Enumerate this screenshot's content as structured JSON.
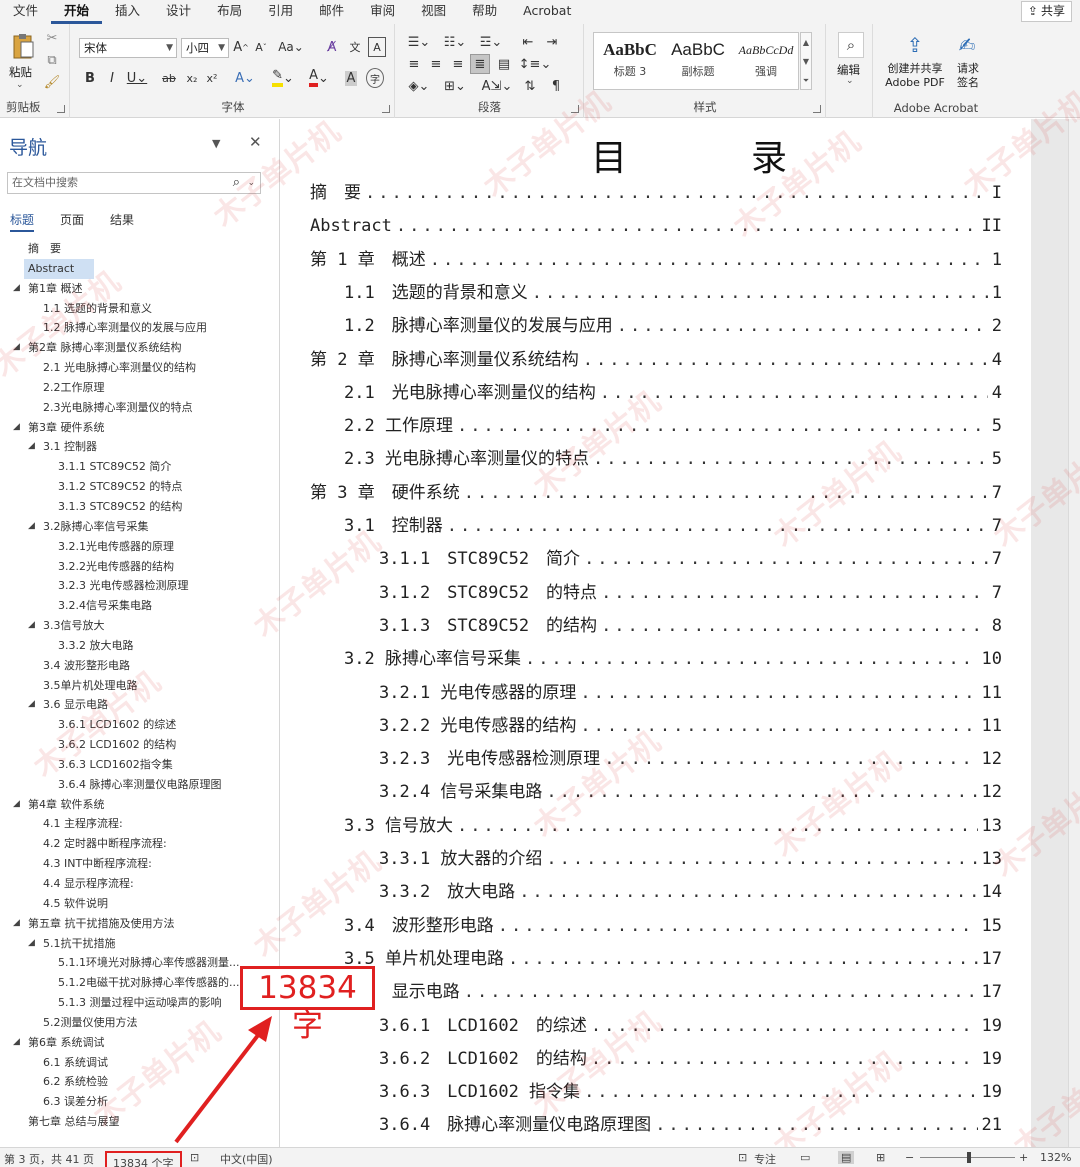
{
  "ribbon": {
    "tabs": [
      "文件",
      "开始",
      "插入",
      "设计",
      "布局",
      "引用",
      "邮件",
      "审阅",
      "视图",
      "帮助",
      "Acrobat"
    ],
    "active_tab": "开始",
    "share_label": "共享",
    "groups": {
      "clipboard": {
        "label": "剪贴板",
        "paste_label": "粘贴"
      },
      "font": {
        "label": "字体",
        "font_name": "宋体",
        "font_size": "小四"
      },
      "paragraph": {
        "label": "段落"
      },
      "styles": {
        "label": "样式",
        "items": [
          {
            "preview": "AaBbC",
            "name": "标题 3"
          },
          {
            "preview": "AaBbC",
            "name": "副标题"
          },
          {
            "preview": "AaBbCcDd",
            "name": "强调"
          }
        ]
      },
      "editing": {
        "label": "编辑"
      },
      "acrobat": {
        "label": "Adobe Acrobat",
        "create_share_line1": "创建并共享",
        "create_share_line2": "Adobe PDF",
        "request_sign_line1": "请求",
        "request_sign_line2": "签名"
      }
    }
  },
  "nav": {
    "title": "导航",
    "search_placeholder": "在文档中搜索",
    "tabs": [
      "标题",
      "页面",
      "结果"
    ],
    "active_tab": "标题",
    "items": [
      {
        "label": "摘　要",
        "level": 1,
        "arrow": false
      },
      {
        "label": "Abstract",
        "level": 1,
        "arrow": false,
        "selected": true
      },
      {
        "label": "第1章 概述",
        "level": 1,
        "arrow": true
      },
      {
        "label": "1.1 选题的背景和意义",
        "level": 2,
        "arrow": false
      },
      {
        "label": "1.2 脉搏心率测量仪的发展与应用",
        "level": 2,
        "arrow": false
      },
      {
        "label": "第2章 脉搏心率测量仪系统结构",
        "level": 1,
        "arrow": true
      },
      {
        "label": "2.1 光电脉搏心率测量仪的结构",
        "level": 2,
        "arrow": false
      },
      {
        "label": "2.2工作原理",
        "level": 2,
        "arrow": false
      },
      {
        "label": "2.3光电脉搏心率测量仪的特点",
        "level": 2,
        "arrow": false
      },
      {
        "label": "第3章 硬件系统",
        "level": 1,
        "arrow": true
      },
      {
        "label": "3.1 控制器",
        "level": 2,
        "arrow": true
      },
      {
        "label": "3.1.1 STC89C52 简介",
        "level": 3,
        "arrow": false
      },
      {
        "label": "3.1.2 STC89C52 的特点",
        "level": 3,
        "arrow": false
      },
      {
        "label": "3.1.3 STC89C52 的结构",
        "level": 3,
        "arrow": false
      },
      {
        "label": "3.2脉搏心率信号采集",
        "level": 2,
        "arrow": true
      },
      {
        "label": "3.2.1光电传感器的原理",
        "level": 3,
        "arrow": false
      },
      {
        "label": "3.2.2光电传感器的结构",
        "level": 3,
        "arrow": false
      },
      {
        "label": "3.2.3 光电传感器检测原理",
        "level": 3,
        "arrow": false
      },
      {
        "label": "3.2.4信号采集电路",
        "level": 3,
        "arrow": false
      },
      {
        "label": "3.3信号放大",
        "level": 2,
        "arrow": true
      },
      {
        "label": "3.3.2 放大电路",
        "level": 3,
        "arrow": false
      },
      {
        "label": "3.4 波形整形电路",
        "level": 2,
        "arrow": false
      },
      {
        "label": "3.5单片机处理电路",
        "level": 2,
        "arrow": false
      },
      {
        "label": "3.6 显示电路",
        "level": 2,
        "arrow": true
      },
      {
        "label": "3.6.1 LCD1602 的综述",
        "level": 3,
        "arrow": false
      },
      {
        "label": "3.6.2 LCD1602 的结构",
        "level": 3,
        "arrow": false
      },
      {
        "label": "3.6.3 LCD1602指令集",
        "level": 3,
        "arrow": false
      },
      {
        "label": "3.6.4 脉搏心率测量仪电路原理图",
        "level": 3,
        "arrow": false
      },
      {
        "label": "第4章 软件系统",
        "level": 1,
        "arrow": true
      },
      {
        "label": "4.1 主程序流程:",
        "level": 2,
        "arrow": false
      },
      {
        "label": "4.2 定时器中断程序流程:",
        "level": 2,
        "arrow": false
      },
      {
        "label": "4.3 INT中断程序流程:",
        "level": 2,
        "arrow": false
      },
      {
        "label": "4.4 显示程序流程:",
        "level": 2,
        "arrow": false
      },
      {
        "label": "4.5 软件说明",
        "level": 2,
        "arrow": false
      },
      {
        "label": "第五章 抗干扰措施及使用方法",
        "level": 1,
        "arrow": true
      },
      {
        "label": "5.1抗干扰措施",
        "level": 2,
        "arrow": true
      },
      {
        "label": "5.1.1环境光对脉搏心率传感器测量...",
        "level": 3,
        "arrow": false
      },
      {
        "label": "5.1.2电磁干扰对脉搏心率传感器的...",
        "level": 3,
        "arrow": false
      },
      {
        "label": "5.1.3 测量过程中运动噪声的影响",
        "level": 3,
        "arrow": false
      },
      {
        "label": "5.2测量仪使用方法",
        "level": 2,
        "arrow": false
      },
      {
        "label": "第6章 系统调试",
        "level": 1,
        "arrow": true
      },
      {
        "label": "6.1 系统调试",
        "level": 2,
        "arrow": false
      },
      {
        "label": "6.2 系统检验",
        "level": 2,
        "arrow": false
      },
      {
        "label": "6.3 误差分析",
        "level": 2,
        "arrow": false
      },
      {
        "label": "第七章 总结与展望",
        "level": 1,
        "arrow": false
      }
    ]
  },
  "document": {
    "toc_title": "目　录",
    "entries": [
      {
        "title": "摘　要",
        "page": "I",
        "level": 1
      },
      {
        "title": "Abstract",
        "page": "II",
        "level": 1
      },
      {
        "title": "第 1 章　概述",
        "page": "1",
        "level": 1
      },
      {
        "title": "1.1　选题的背景和意义",
        "page": "1",
        "level": 2
      },
      {
        "title": "1.2　脉搏心率测量仪的发展与应用",
        "page": "2",
        "level": 2
      },
      {
        "title": "第 2 章　脉搏心率测量仪系统结构",
        "page": "4",
        "level": 1
      },
      {
        "title": "2.1　光电脉搏心率测量仪的结构",
        "page": "4",
        "level": 2
      },
      {
        "title": "2.2 工作原理",
        "page": "5",
        "level": 2
      },
      {
        "title": "2.3 光电脉搏心率测量仪的特点",
        "page": "5",
        "level": 2
      },
      {
        "title": "第 3 章　硬件系统",
        "page": "7",
        "level": 1
      },
      {
        "title": "3.1　控制器",
        "page": "7",
        "level": 2
      },
      {
        "title": "3.1.1　STC89C52　简介",
        "page": "7",
        "level": 3
      },
      {
        "title": "3.1.2　STC89C52　的特点",
        "page": "7",
        "level": 3
      },
      {
        "title": "3.1.3　STC89C52　的结构",
        "page": "8",
        "level": 3
      },
      {
        "title": "3.2 脉搏心率信号采集",
        "page": "10",
        "level": 2
      },
      {
        "title": "3.2.1 光电传感器的原理",
        "page": "11",
        "level": 3
      },
      {
        "title": "3.2.2 光电传感器的结构",
        "page": "11",
        "level": 3
      },
      {
        "title": "3.2.3　光电传感器检测原理",
        "page": "12",
        "level": 3
      },
      {
        "title": "3.2.4 信号采集电路",
        "page": "12",
        "level": 3
      },
      {
        "title": "3.3 信号放大",
        "page": "13",
        "level": 2
      },
      {
        "title": "3.3.1 放大器的介绍",
        "page": "13",
        "level": 3
      },
      {
        "title": "3.3.2　放大电路",
        "page": "14",
        "level": 3
      },
      {
        "title": "3.4　波形整形电路",
        "page": "15",
        "level": 2
      },
      {
        "title": "3.5 单片机处理电路",
        "page": "17",
        "level": 2
      },
      {
        "title": "3.6　显示电路",
        "page": "17",
        "level": 2
      },
      {
        "title": "3.6.1　LCD1602　的综述",
        "page": "19",
        "level": 3
      },
      {
        "title": "3.6.2　LCD1602　的结构",
        "page": "19",
        "level": 3
      },
      {
        "title": "3.6.3　LCD1602 指令集",
        "page": "19",
        "level": 3
      },
      {
        "title": "3.6.4　脉搏心率测量仪电路原理图",
        "page": "21",
        "level": 3
      }
    ]
  },
  "status": {
    "page_info": "第 3 页，共 41 页",
    "word_count": "13834 个字",
    "language": "中文(中国)",
    "focus": "专注",
    "zoom": "132%"
  },
  "annotation": {
    "text": "13834字"
  },
  "watermark": {
    "text": "木子单片机"
  }
}
